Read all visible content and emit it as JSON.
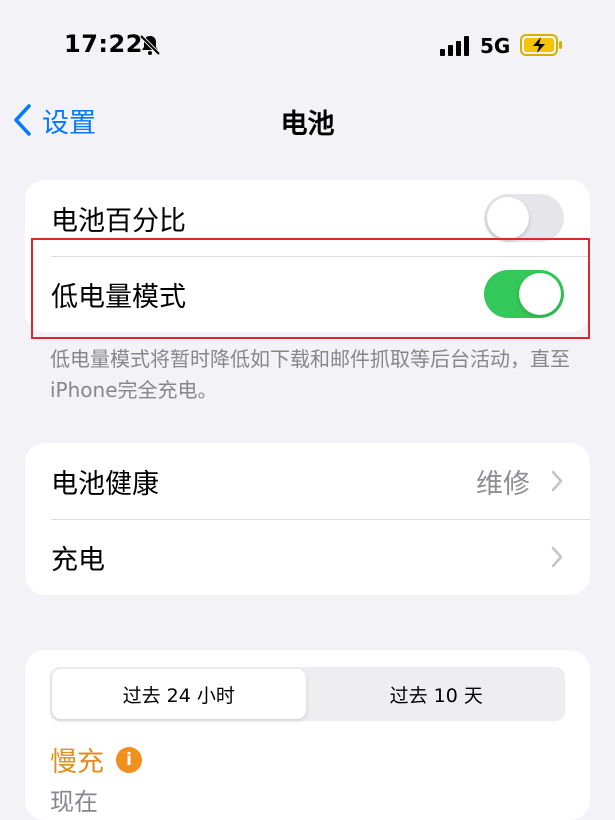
{
  "status_bar": {
    "time": "17:22",
    "network": "5G"
  },
  "nav": {
    "back_label": "设置",
    "title": "电池"
  },
  "group1": {
    "battery_percentage": {
      "label": "电池百分比",
      "enabled": false
    },
    "low_power_mode": {
      "label": "低电量模式",
      "enabled": true
    },
    "footnote": "低电量模式将暂时降低如下载和邮件抓取等后台活动，直至iPhone完全充电。"
  },
  "group2": {
    "battery_health": {
      "label": "电池健康",
      "value": "维修"
    },
    "charging": {
      "label": "充电"
    }
  },
  "usage": {
    "segments": [
      "过去 24 小时",
      "过去 10 天"
    ],
    "selected_segment": 0,
    "slow_charge_label": "慢充",
    "info_icon_glyph": "i",
    "now_label": "现在"
  },
  "colors": {
    "accent": "#007aff",
    "toggle_on": "#34c759",
    "highlight": "#e0262b",
    "warning": "#f0901e"
  },
  "icons": [
    "bell-slash-icon",
    "signal-icon",
    "battery-charging-icon",
    "back-chevron-icon",
    "chevron-right-icon",
    "info-icon"
  ]
}
